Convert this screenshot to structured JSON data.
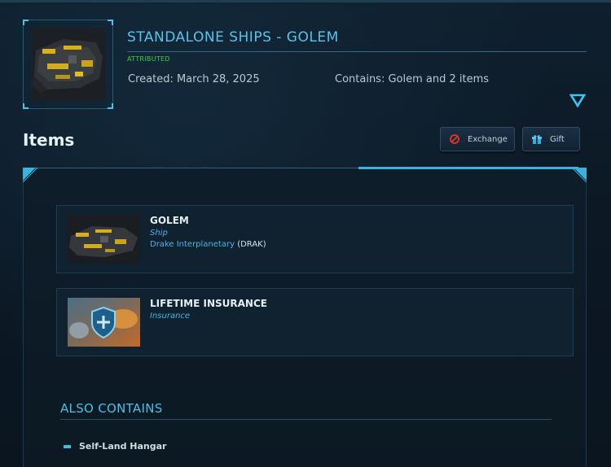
{
  "pledge": {
    "title": "STANDALONE SHIPS - GOLEM",
    "status": "ATTRIBUTED",
    "created": "Created: March 28, 2025",
    "contains": "Contains: Golem and 2 items"
  },
  "items_section": {
    "heading": "Items",
    "exchange_label": "Exchange",
    "gift_label": "Gift"
  },
  "items": [
    {
      "name": "GOLEM",
      "type": "Ship",
      "manufacturer": "Drake Interplanetary",
      "manufacturer_code": "(DRAK)"
    },
    {
      "name": "LIFETIME INSURANCE",
      "type": "Insurance"
    }
  ],
  "also_contains": {
    "title": "ALSO CONTAINS",
    "items": [
      "Self-Land Hangar"
    ]
  },
  "colors": {
    "accent": "#4fbde6",
    "attributed": "#3fcf3f",
    "background": "#0b1722"
  },
  "icons": {
    "expand": "chevron-down-triangle-icon",
    "exchange": "no-entry-icon",
    "gift": "gift-box-icon"
  }
}
